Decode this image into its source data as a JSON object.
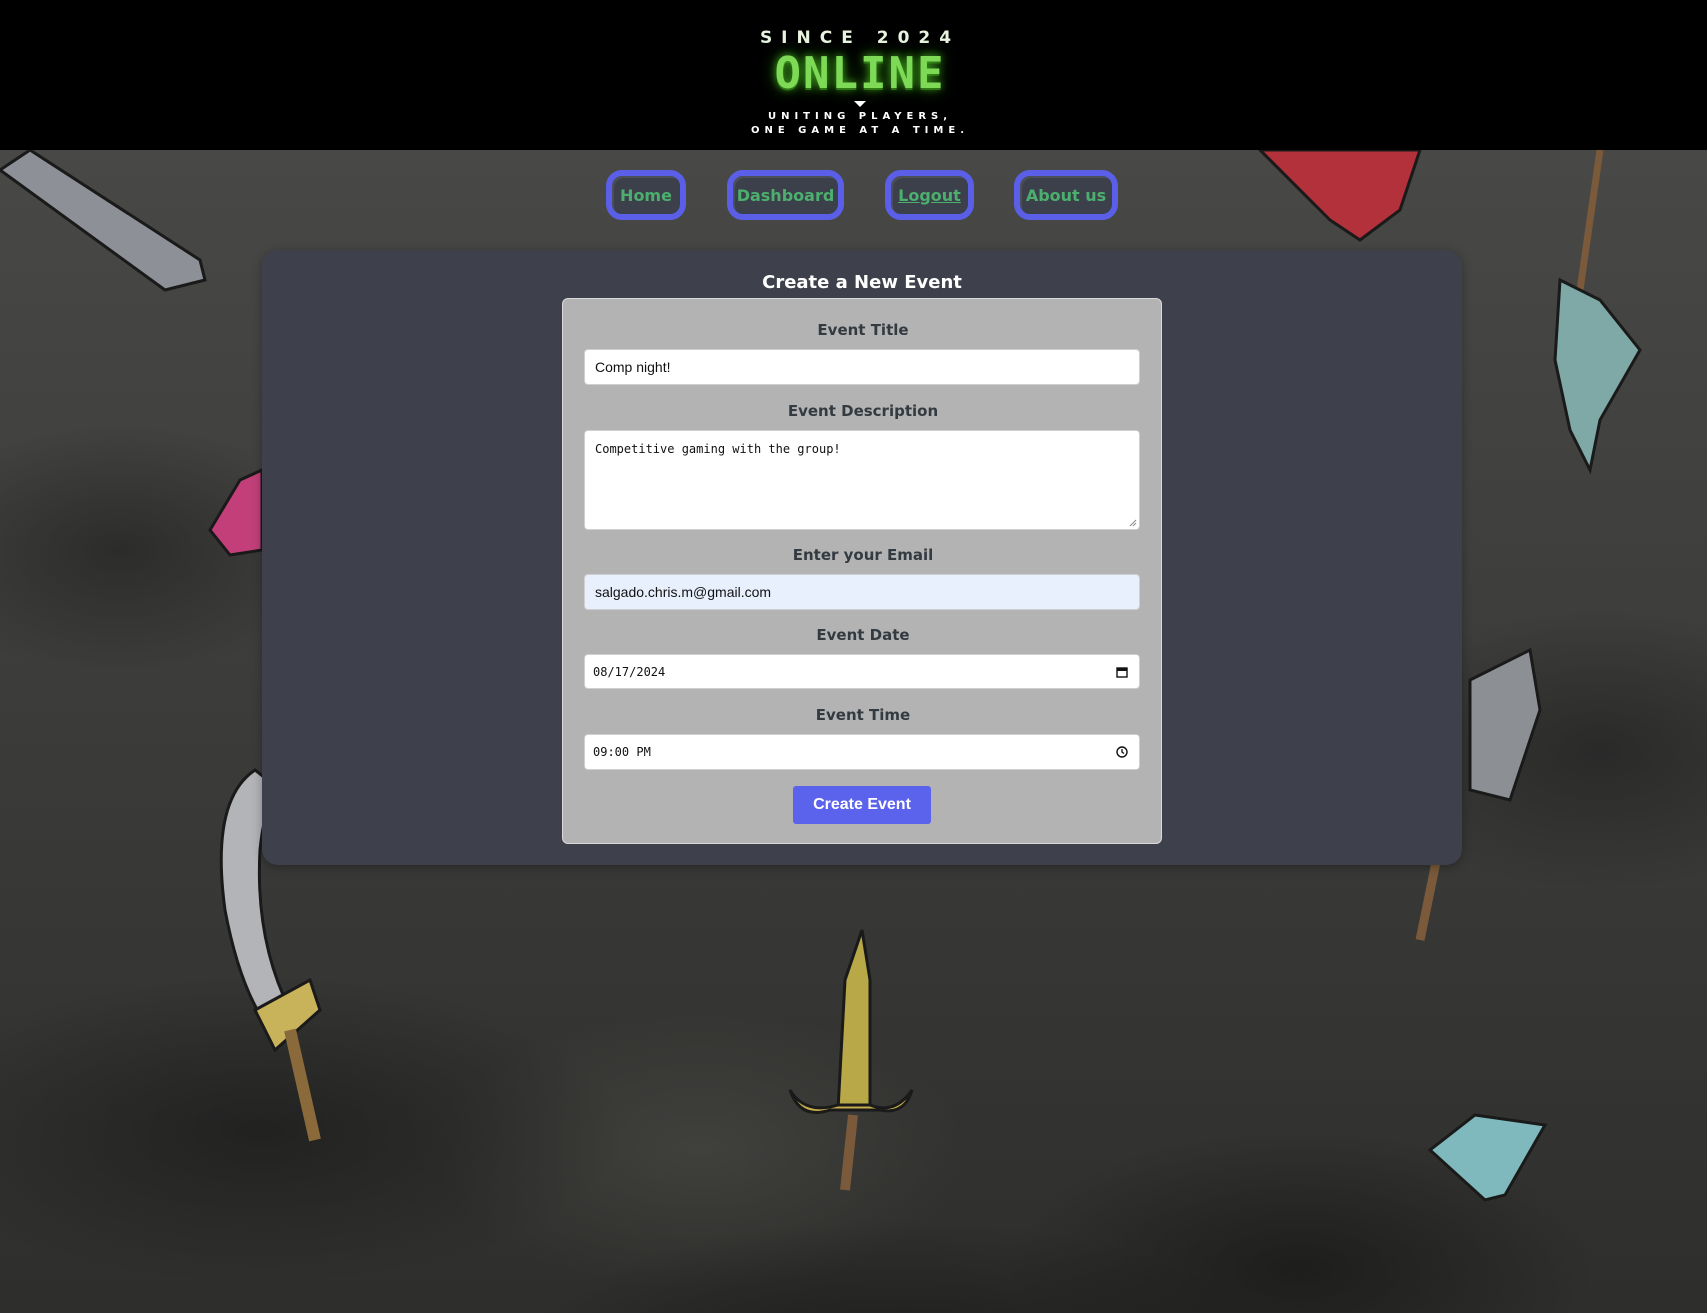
{
  "logo": {
    "since": "SINCE 2024",
    "name": "ONLINE",
    "tagline_line1": "UNITING PLAYERS,",
    "tagline_line2": "ONE GAME AT A TIME."
  },
  "nav": {
    "items": [
      {
        "label": "Home"
      },
      {
        "label": "Dashboard"
      },
      {
        "label": "Logout"
      },
      {
        "label": "About us"
      }
    ]
  },
  "form": {
    "heading": "Create a New Event",
    "fields": {
      "title": {
        "label": "Event Title",
        "value": "Comp night!"
      },
      "description": {
        "label": "Event Description",
        "value": "Competitive gaming with the group!"
      },
      "email": {
        "label": "Enter your Email",
        "value": "salgado.chris.m@gmail.com"
      },
      "date": {
        "label": "Event Date",
        "value": "08/17/2024",
        "icon": "calendar-icon"
      },
      "time": {
        "label": "Event Time",
        "value": "09:00 PM",
        "icon": "clock-icon"
      }
    },
    "submit_label": "Create Event"
  },
  "colors": {
    "header_bg": "#000000",
    "logo_green": "#7ed957",
    "nav_border": "#5b5fe8",
    "nav_text": "#4caf6e",
    "panel_bg": "#3e414b",
    "form_bg": "#b3b3b3",
    "submit_bg": "#5b63ed",
    "email_autofill_bg": "#e8f0fe"
  }
}
